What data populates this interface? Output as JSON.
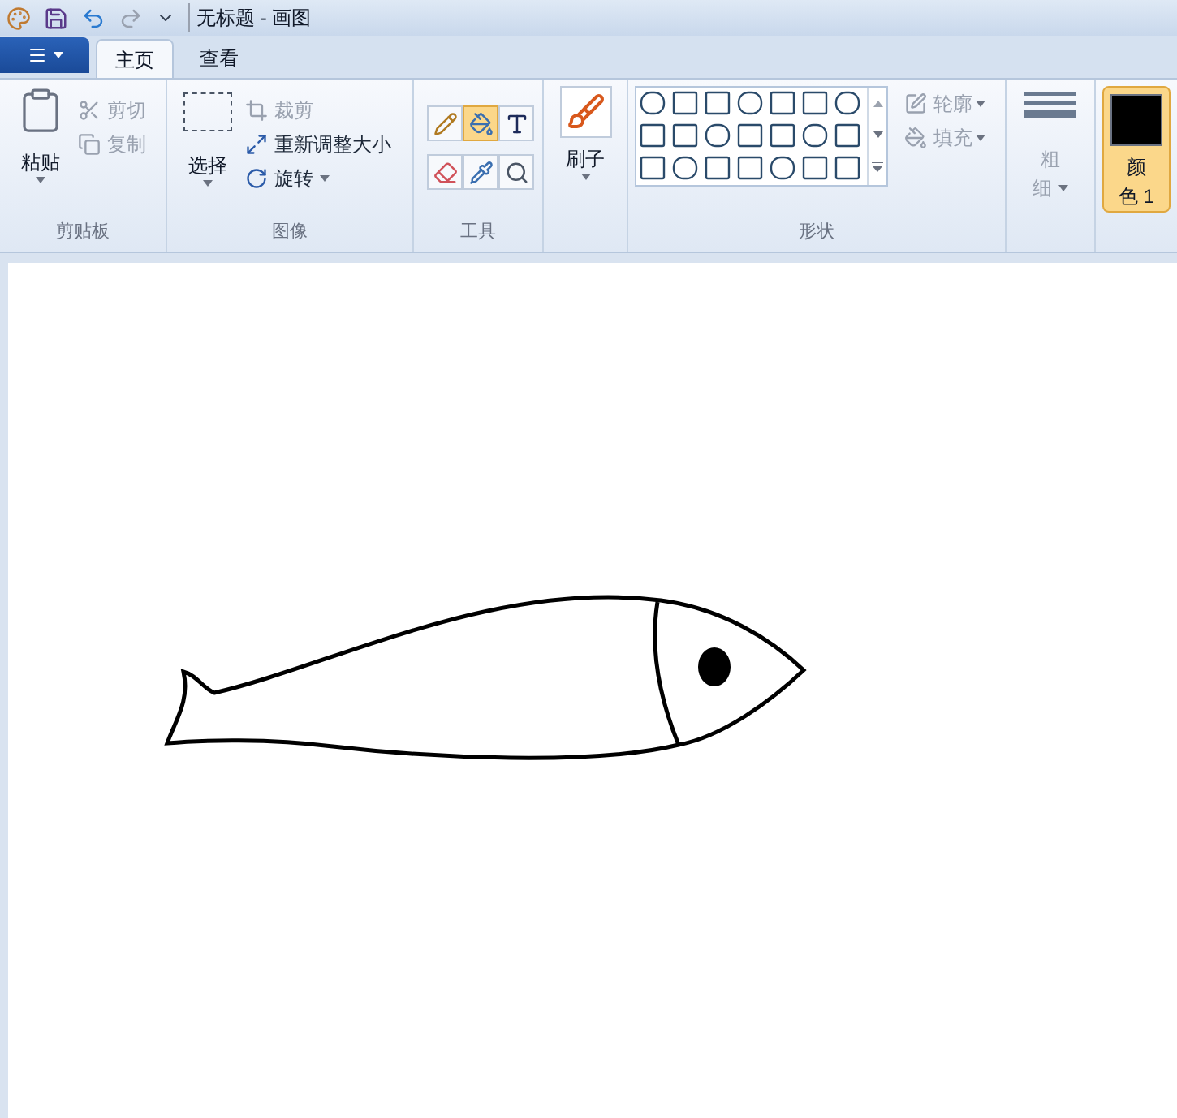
{
  "title_bar": {
    "title": "无标题 - 画图"
  },
  "tabs": [
    {
      "label": "主页",
      "selected": true
    },
    {
      "label": "查看",
      "selected": false
    }
  ],
  "clipboard": {
    "paste": "粘贴",
    "cut": {
      "label": "剪切",
      "disabled": true
    },
    "copy": {
      "label": "复制",
      "disabled": true
    },
    "group_label": "剪贴板"
  },
  "image": {
    "select": "选择",
    "crop": {
      "label": "裁剪",
      "disabled": true
    },
    "resize": {
      "label": "重新调整大小",
      "disabled": false
    },
    "rotate": {
      "label": "旋转",
      "disabled": false
    },
    "group_label": "图像"
  },
  "tools": {
    "items": [
      {
        "kind": "pencil",
        "selected": false
      },
      {
        "kind": "fill",
        "selected": true
      },
      {
        "kind": "text",
        "selected": false
      },
      {
        "kind": "eraser",
        "selected": false
      },
      {
        "kind": "picker",
        "selected": false
      },
      {
        "kind": "magnifier",
        "selected": false
      }
    ],
    "group_label": "工具"
  },
  "brushes": {
    "label": "刷子"
  },
  "shapes": {
    "outline": {
      "label": "轮廓",
      "disabled": true
    },
    "fill": {
      "label": "填充",
      "disabled": true
    },
    "group_label": "形状"
  },
  "size": {
    "label_line_1": "粗",
    "label_line_2": "细",
    "disabled": true
  },
  "color_1": {
    "label_line_1": "颜",
    "label_line_2": "色 1",
    "selected": true
  }
}
